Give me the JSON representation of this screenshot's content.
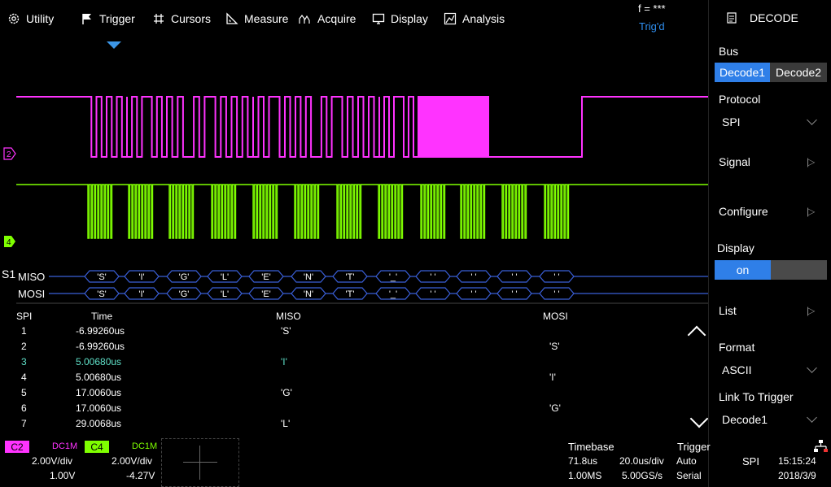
{
  "menu": {
    "items": [
      {
        "label": "Utility",
        "icon": "gear-icon"
      },
      {
        "label": "Trigger",
        "icon": "flag-icon"
      },
      {
        "label": "Cursors",
        "icon": "hash-icon"
      },
      {
        "label": "Measure",
        "icon": "ruler-icon"
      },
      {
        "label": "Acquire",
        "icon": "acquire-icon"
      },
      {
        "label": "Display",
        "icon": "monitor-icon"
      },
      {
        "label": "Analysis",
        "icon": "analysis-icon"
      }
    ],
    "freq": "f = ***",
    "trig_status": "Trig'd"
  },
  "channels": {
    "c2_marker": "2",
    "c4_marker": "4",
    "c2_color": "#ff33ff",
    "c4_color": "#7fff00"
  },
  "bus": {
    "label": "S1",
    "miso_label": "MISO",
    "mosi_label": "MOSI",
    "miso_frames": [
      "'S'",
      "'I'",
      "'G'",
      "'L'",
      "'E'",
      "'N'",
      "'T'",
      "'_'",
      "' '",
      "' '",
      "' '",
      "' '"
    ],
    "mosi_frames": [
      "'S'",
      "'I'",
      "'G'",
      "'L'",
      "'E'",
      "'N'",
      "'T'",
      "'_'",
      "' '",
      "' '",
      "' '",
      "' '"
    ],
    "color": "#3a5fd8"
  },
  "table": {
    "headers": {
      "spi": "SPI",
      "time": "Time",
      "miso": "MISO",
      "mosi": "MOSI"
    },
    "rows": [
      {
        "num": "1",
        "time": "-6.99260us",
        "miso": "'S'",
        "mosi": ""
      },
      {
        "num": "2",
        "time": "-6.99260us",
        "miso": "",
        "mosi": "'S'"
      },
      {
        "num": "3",
        "time": "5.00680us",
        "miso": "'I'",
        "mosi": "",
        "highlight": true
      },
      {
        "num": "4",
        "time": "5.00680us",
        "miso": "",
        "mosi": "'I'"
      },
      {
        "num": "5",
        "time": "17.0060us",
        "miso": "'G'",
        "mosi": ""
      },
      {
        "num": "6",
        "time": "17.0060us",
        "miso": "",
        "mosi": "'G'"
      },
      {
        "num": "7",
        "time": "29.0068us",
        "miso": "'L'",
        "mosi": ""
      }
    ],
    "highlight_color": "#5fe0c8"
  },
  "panel": {
    "title": "DECODE",
    "bus_label": "Bus",
    "decode1": "Decode1",
    "decode2": "Decode2",
    "protocol_label": "Protocol",
    "protocol_value": "SPI",
    "signal_label": "Signal",
    "configure_label": "Configure",
    "display_label": "Display",
    "display_value": "on",
    "list_label": "List",
    "format_label": "Format",
    "format_value": "ASCII",
    "link_label": "Link To Trigger",
    "link_value": "Decode1",
    "accent": "#2f7fe8"
  },
  "bottom": {
    "c2": {
      "tag": "C2",
      "coupling": "DC1M",
      "vdiv": "2.00V/div",
      "offset": "1.00V"
    },
    "c4": {
      "tag": "C4",
      "coupling": "DC1M",
      "vdiv": "2.00V/div",
      "offset": "-4.27V"
    },
    "timebase_label": "Timebase",
    "delay": "71.8us",
    "tdiv": "20.0us/div",
    "memory": "1.00MS",
    "srate": "5.00GS/s",
    "trigger_label": "Trigger",
    "trigger_mode": "Auto",
    "trigger_type": "Serial",
    "decode_mode": "SPI",
    "time": "15:15:24",
    "date": "2018/3/9"
  }
}
